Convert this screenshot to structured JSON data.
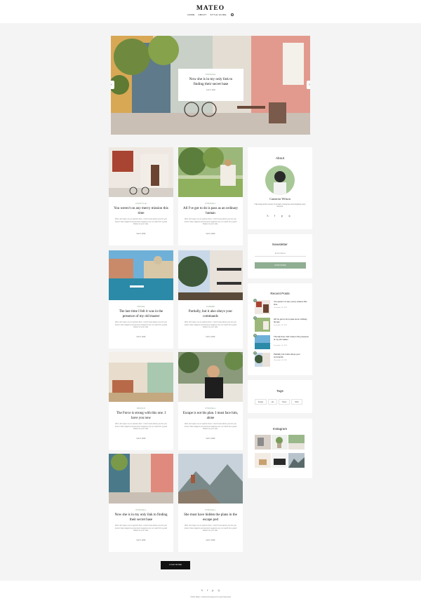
{
  "site": {
    "logo": "MATEO",
    "nav": [
      "HOME",
      "ABOUT",
      "STYLE GUIDE"
    ]
  },
  "hero": {
    "category": "STRAVELL",
    "title": "Now she is in my only link to finding their secret base",
    "date": "Feb 5, 2020"
  },
  "posts": [
    {
      "category": "LIFESTYLE",
      "title": "You weren't on any mercy mission this time",
      "excerpt": "Well, don't give me an opinion then. I don't know about you but you know I hate religions and ancient weapons are no match for a good blaster at your side.",
      "date": "Feb 5, 2020"
    },
    {
      "category": "STRAVELL",
      "title": "All I've got to do is pass as an ordinary human",
      "excerpt": "Well, don't give me an opinion then. I don't know about you but you know I hate religions and ancient weapons are no match for a good blaster at your side.",
      "date": "Feb 5, 2020"
    },
    {
      "category": "TRAVEL",
      "title": "The last time I felt it was in the presence of my old master",
      "excerpt": "Well, don't give me an opinion then. I don't know about you but you know I hate religions and ancient weapons are no match for a good blaster at your side.",
      "date": "Feb 5, 2020"
    },
    {
      "category": "CAREER",
      "title": "Partially, but it also obeys your commands",
      "excerpt": "Well, don't give me an opinion then. I don't know about you but you know I hate religions and ancient weapons are no match for a good blaster at your side.",
      "date": "Feb 5, 2020"
    },
    {
      "category": "DESIGN",
      "title": "The Force is strong with this one. I have you now",
      "excerpt": "Well, don't give me an opinion then. I don't know about you but you know I hate religions and ancient weapons are no match for a good blaster at your side.",
      "date": "Feb 5, 2020"
    },
    {
      "category": "STRAVELL",
      "title": "Escape is not his plan. I must face him, alone",
      "excerpt": "Well, don't give me an opinion then. I don't know about you but you know I hate religions and ancient weapons are no match for a good blaster at your side.",
      "date": "Feb 5, 2020"
    },
    {
      "category": "STRAVELL",
      "title": "Now she is in my only link to finding their secret base",
      "excerpt": "Well, don't give me an opinion then. I don't know about you but you know I hate religions and ancient weapons are no match for a good blaster at your side.",
      "date": "Feb 5, 2020"
    },
    {
      "category": "STRAVELL",
      "title": "She must have hidden the plans in the escape pod",
      "excerpt": "Well, don't give me an opinion then. I don't know about you but you know I hate religions and ancient weapons are no match for a good blaster at your side.",
      "date": "Feb 5, 2020"
    }
  ],
  "about": {
    "title": "About",
    "name": "Cameron Wilson",
    "bio": "I like being at the center of emotion, being free and stopping every moment."
  },
  "newsletter": {
    "title": "Newsletter",
    "placeholder": "Email Address",
    "button": "SUBSCRIBE"
  },
  "recent": {
    "title": "Recent Posts",
    "items": [
      {
        "num": "1",
        "title": "You weren't on any mercy mission this time",
        "date": "December 10, 2021"
      },
      {
        "num": "2",
        "title": "All I've got to do is pass as an ordinary human",
        "date": "December 10, 2021"
      },
      {
        "num": "3",
        "title": "The last time I felt it was in the presence of my old master",
        "date": "December 10, 2021"
      },
      {
        "num": "4",
        "title": "Partially, but it also obeys your commands",
        "date": "December 10, 2021"
      }
    ]
  },
  "tags": {
    "title": "Tags",
    "items": [
      "Design",
      "Life",
      "Travel",
      "Work"
    ]
  },
  "instagram": {
    "title": "Instagram"
  },
  "load_more": "LOAD MORE",
  "footer": {
    "copyright": "©2021 Mateo. Crafted & Designed by Ioana Skemerka"
  },
  "colors": {
    "accent": "#8fae92",
    "background": "#f4f4f4",
    "button_dark": "#111111"
  }
}
